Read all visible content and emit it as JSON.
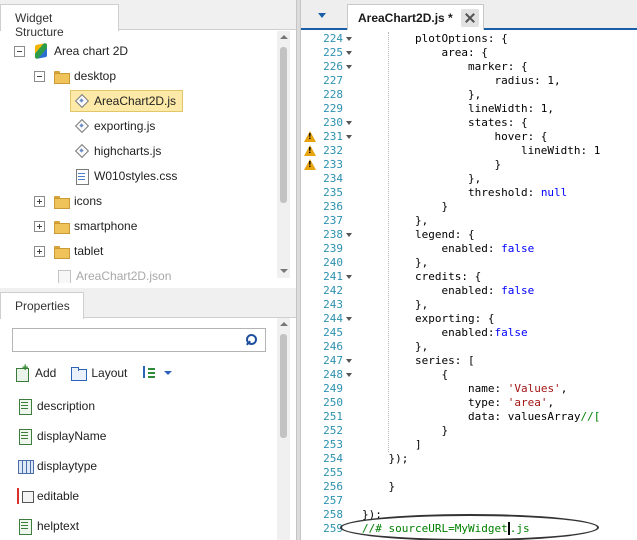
{
  "widget_structure": {
    "title": "Widget Structure",
    "tree": [
      {
        "label": "Area chart 2D",
        "icon": "project-cube-icon",
        "expander": "minus"
      },
      {
        "label": "desktop",
        "icon": "folder-icon",
        "expander": "minus"
      },
      {
        "label": "AreaChart2D.js",
        "icon": "js-file-icon",
        "selected": true
      },
      {
        "label": "exporting.js",
        "icon": "js-file-icon"
      },
      {
        "label": "highcharts.js",
        "icon": "js-file-icon"
      },
      {
        "label": "W010styles.css",
        "icon": "css-file-icon"
      },
      {
        "label": "icons",
        "icon": "folder-icon",
        "expander": "plus"
      },
      {
        "label": "smartphone",
        "icon": "folder-icon",
        "expander": "plus"
      },
      {
        "label": "tablet",
        "icon": "folder-icon",
        "expander": "plus"
      },
      {
        "label": "AreaChart2D.json",
        "icon": "json-file-icon"
      }
    ]
  },
  "properties": {
    "title": "Properties",
    "search_placeholder": "",
    "toolbar": {
      "add_label": "Add",
      "layout_label": "Layout"
    },
    "items": [
      {
        "label": "description",
        "icon": "property-icon"
      },
      {
        "label": "displayName",
        "icon": "property-icon"
      },
      {
        "label": "displaytype",
        "icon": "property-type-icon"
      },
      {
        "label": "editable",
        "icon": "property-editable-icon"
      },
      {
        "label": "helptext",
        "icon": "property-icon"
      }
    ]
  },
  "editor": {
    "tab_label": "AreaChart2D.js *",
    "lines": [
      {
        "n": "224",
        "fold": true,
        "warn": false,
        "code": "        plotOptions: {"
      },
      {
        "n": "225",
        "fold": true,
        "warn": false,
        "code": "            area: {"
      },
      {
        "n": "226",
        "fold": true,
        "warn": false,
        "code": "                marker: {"
      },
      {
        "n": "227",
        "fold": false,
        "warn": false,
        "code": "                    radius: 1,"
      },
      {
        "n": "228",
        "fold": false,
        "warn": false,
        "code": "                },"
      },
      {
        "n": "229",
        "fold": false,
        "warn": false,
        "code": "                lineWidth: 1,"
      },
      {
        "n": "230",
        "fold": true,
        "warn": false,
        "code": "                states: {"
      },
      {
        "n": "231",
        "fold": true,
        "warn": true,
        "code": "                    hover: {"
      },
      {
        "n": "232",
        "fold": false,
        "warn": true,
        "code": "                        lineWidth: 1"
      },
      {
        "n": "233",
        "fold": false,
        "warn": true,
        "code": "                    }"
      },
      {
        "n": "234",
        "fold": false,
        "warn": false,
        "code": "                },"
      },
      {
        "n": "235",
        "fold": false,
        "warn": false,
        "code": "                threshold: null"
      },
      {
        "n": "236",
        "fold": false,
        "warn": false,
        "code": "            }"
      },
      {
        "n": "237",
        "fold": false,
        "warn": false,
        "code": "        },"
      },
      {
        "n": "238",
        "fold": true,
        "warn": false,
        "code": "        legend: {"
      },
      {
        "n": "239",
        "fold": false,
        "warn": false,
        "code": "            enabled: false"
      },
      {
        "n": "240",
        "fold": false,
        "warn": false,
        "code": "        },"
      },
      {
        "n": "241",
        "fold": true,
        "warn": false,
        "code": "        credits: {"
      },
      {
        "n": "242",
        "fold": false,
        "warn": false,
        "code": "            enabled: false"
      },
      {
        "n": "243",
        "fold": false,
        "warn": false,
        "code": "        },"
      },
      {
        "n": "244",
        "fold": true,
        "warn": false,
        "code": "        exporting: {"
      },
      {
        "n": "245",
        "fold": false,
        "warn": false,
        "code": "            enabled:false"
      },
      {
        "n": "246",
        "fold": false,
        "warn": false,
        "code": "        },"
      },
      {
        "n": "247",
        "fold": true,
        "warn": false,
        "code": "        series: ["
      },
      {
        "n": "248",
        "fold": true,
        "warn": false,
        "code": "            {"
      },
      {
        "n": "249",
        "fold": false,
        "warn": false,
        "code": "                name: 'Values',"
      },
      {
        "n": "250",
        "fold": false,
        "warn": false,
        "code": "                type: 'area',"
      },
      {
        "n": "251",
        "fold": false,
        "warn": false,
        "code": "                data: valuesArray//["
      },
      {
        "n": "252",
        "fold": false,
        "warn": false,
        "code": "            }"
      },
      {
        "n": "253",
        "fold": false,
        "warn": false,
        "code": "        ]"
      },
      {
        "n": "254",
        "fold": false,
        "warn": false,
        "code": "    });"
      },
      {
        "n": "255",
        "fold": false,
        "warn": false,
        "code": ""
      },
      {
        "n": "256",
        "fold": false,
        "warn": false,
        "code": "    }"
      },
      {
        "n": "257",
        "fold": false,
        "warn": false,
        "code": ""
      },
      {
        "n": "258",
        "fold": false,
        "warn": false,
        "code": "});"
      },
      {
        "n": "259",
        "fold": false,
        "warn": false,
        "code": "//# sourceURL=MyWidget.js"
      }
    ],
    "colors": {
      "keyword": "#0000ff",
      "string": "#a31515",
      "comment": "#008000",
      "line_number": "#2b91af",
      "warning": "#e7a40e"
    }
  }
}
